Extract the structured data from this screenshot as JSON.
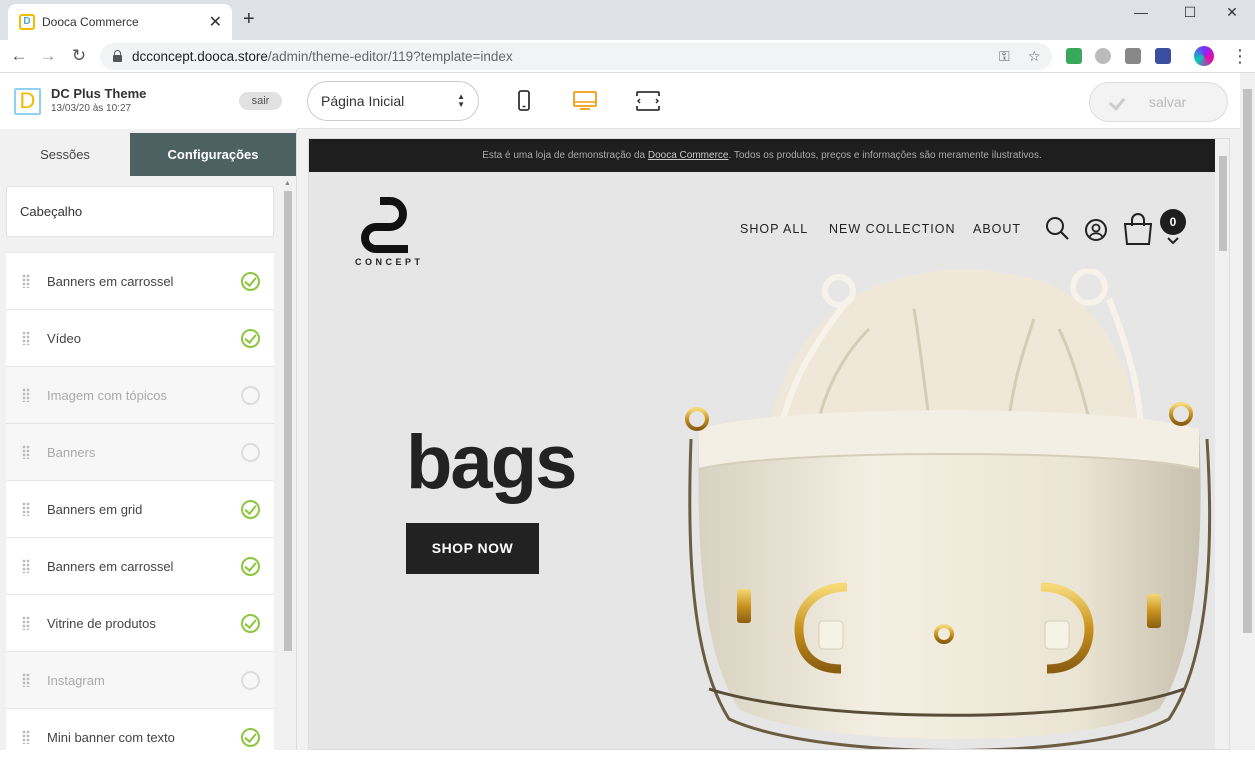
{
  "browser": {
    "tab_title": "Dooca Commerce",
    "favicon_letter": "D",
    "url_host": "dcconcept.dooca.store",
    "url_path": "/admin/theme-editor/119?template=index"
  },
  "theme": {
    "logo_letter": "D",
    "name": "DC Plus Theme",
    "date": "13/03/20 às 10:27",
    "logout_label": "sair"
  },
  "tabs": {
    "sessions": "Sessões",
    "settings": "Configurações"
  },
  "header_section": "Cabeçalho",
  "sections": [
    {
      "label": "Banners em carrossel",
      "active": true
    },
    {
      "label": "Vídeo",
      "active": true
    },
    {
      "label": "Imagem com tópicos",
      "active": false
    },
    {
      "label": "Banners",
      "active": false
    },
    {
      "label": "Banners em grid",
      "active": true
    },
    {
      "label": "Banners em carrossel",
      "active": true
    },
    {
      "label": "Vitrine de produtos",
      "active": true
    },
    {
      "label": "Instagram",
      "active": false
    },
    {
      "label": "Mini banner com texto",
      "active": true
    }
  ],
  "editor": {
    "page_select": "Página Inicial",
    "save_label": "salvar",
    "active_device": "desktop"
  },
  "store": {
    "demo_notice_before": "Esta é uma loja de demonstração da ",
    "demo_notice_link": "Dooca Commerce",
    "demo_notice_after": ". Todos os produtos, preços e informações são meramente ilustrativos.",
    "logo_word": "CONCEPT",
    "nav": [
      "SHOP ALL",
      "NEW COLLECTION",
      "ABOUT"
    ],
    "cart_count": "0",
    "hero_title": "bags",
    "hero_button": "SHOP NOW"
  },
  "colors": {
    "accent_orange": "#f39c12",
    "settings_tab": "#4d6163",
    "check_green": "#8dc63f"
  }
}
